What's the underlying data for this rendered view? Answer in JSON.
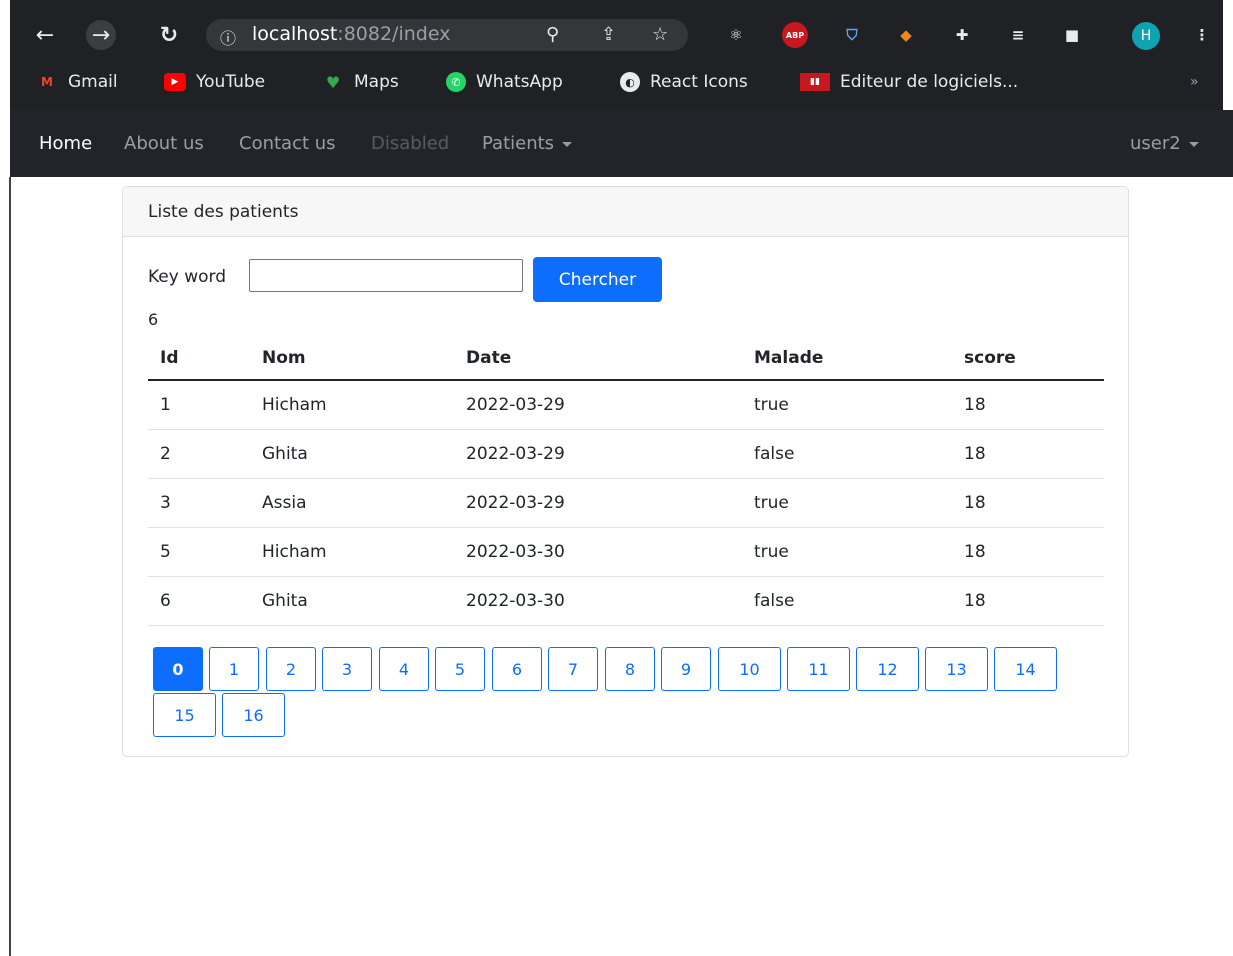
{
  "browser": {
    "url_host": "localhost",
    "url_path": ":8082/index",
    "profile_initial": "H",
    "bookmarks": [
      {
        "label": "Gmail",
        "icon": "gmail-icon",
        "color": "#ea4335"
      },
      {
        "label": "YouTube",
        "icon": "youtube-icon",
        "color": "#ff0000"
      },
      {
        "label": "Maps",
        "icon": "maps-icon",
        "color": "#34a853"
      },
      {
        "label": "WhatsApp",
        "icon": "whatsapp-icon",
        "color": "#25d366"
      },
      {
        "label": "React Icons",
        "icon": "react-icons-icon",
        "color": "#e8eaed"
      },
      {
        "label": "Editeur de logiciels...",
        "icon": "editeur-icon",
        "color": "#c7181f"
      }
    ],
    "extension_abp_label": "ABP"
  },
  "navbar": {
    "items": [
      {
        "label": "Home",
        "state": "active"
      },
      {
        "label": "About us",
        "state": "normal"
      },
      {
        "label": "Contact us",
        "state": "normal"
      },
      {
        "label": "Disabled",
        "state": "disabled"
      },
      {
        "label": "Patients",
        "state": "dropdown"
      }
    ],
    "user_label": "user2"
  },
  "card": {
    "title": "Liste des patients",
    "search": {
      "label": "Key word",
      "value": "",
      "button_label": "Chercher"
    },
    "count": "6"
  },
  "table": {
    "headers": [
      "Id",
      "Nom",
      "Date",
      "Malade",
      "score"
    ],
    "rows": [
      [
        "1",
        "Hicham",
        "2022-03-29",
        "true",
        "18"
      ],
      [
        "2",
        "Ghita",
        "2022-03-29",
        "false",
        "18"
      ],
      [
        "3",
        "Assia",
        "2022-03-29",
        "true",
        "18"
      ],
      [
        "5",
        "Hicham",
        "2022-03-30",
        "true",
        "18"
      ],
      [
        "6",
        "Ghita",
        "2022-03-30",
        "false",
        "18"
      ]
    ]
  },
  "pagination": {
    "pages": [
      "0",
      "1",
      "2",
      "3",
      "4",
      "5",
      "6",
      "7",
      "8",
      "9",
      "10",
      "11",
      "12",
      "13",
      "14",
      "15",
      "16"
    ],
    "active": "0"
  },
  "colors": {
    "primary": "#0d6efd",
    "navbar_bg": "#212529",
    "chrome_bg": "#202124"
  }
}
